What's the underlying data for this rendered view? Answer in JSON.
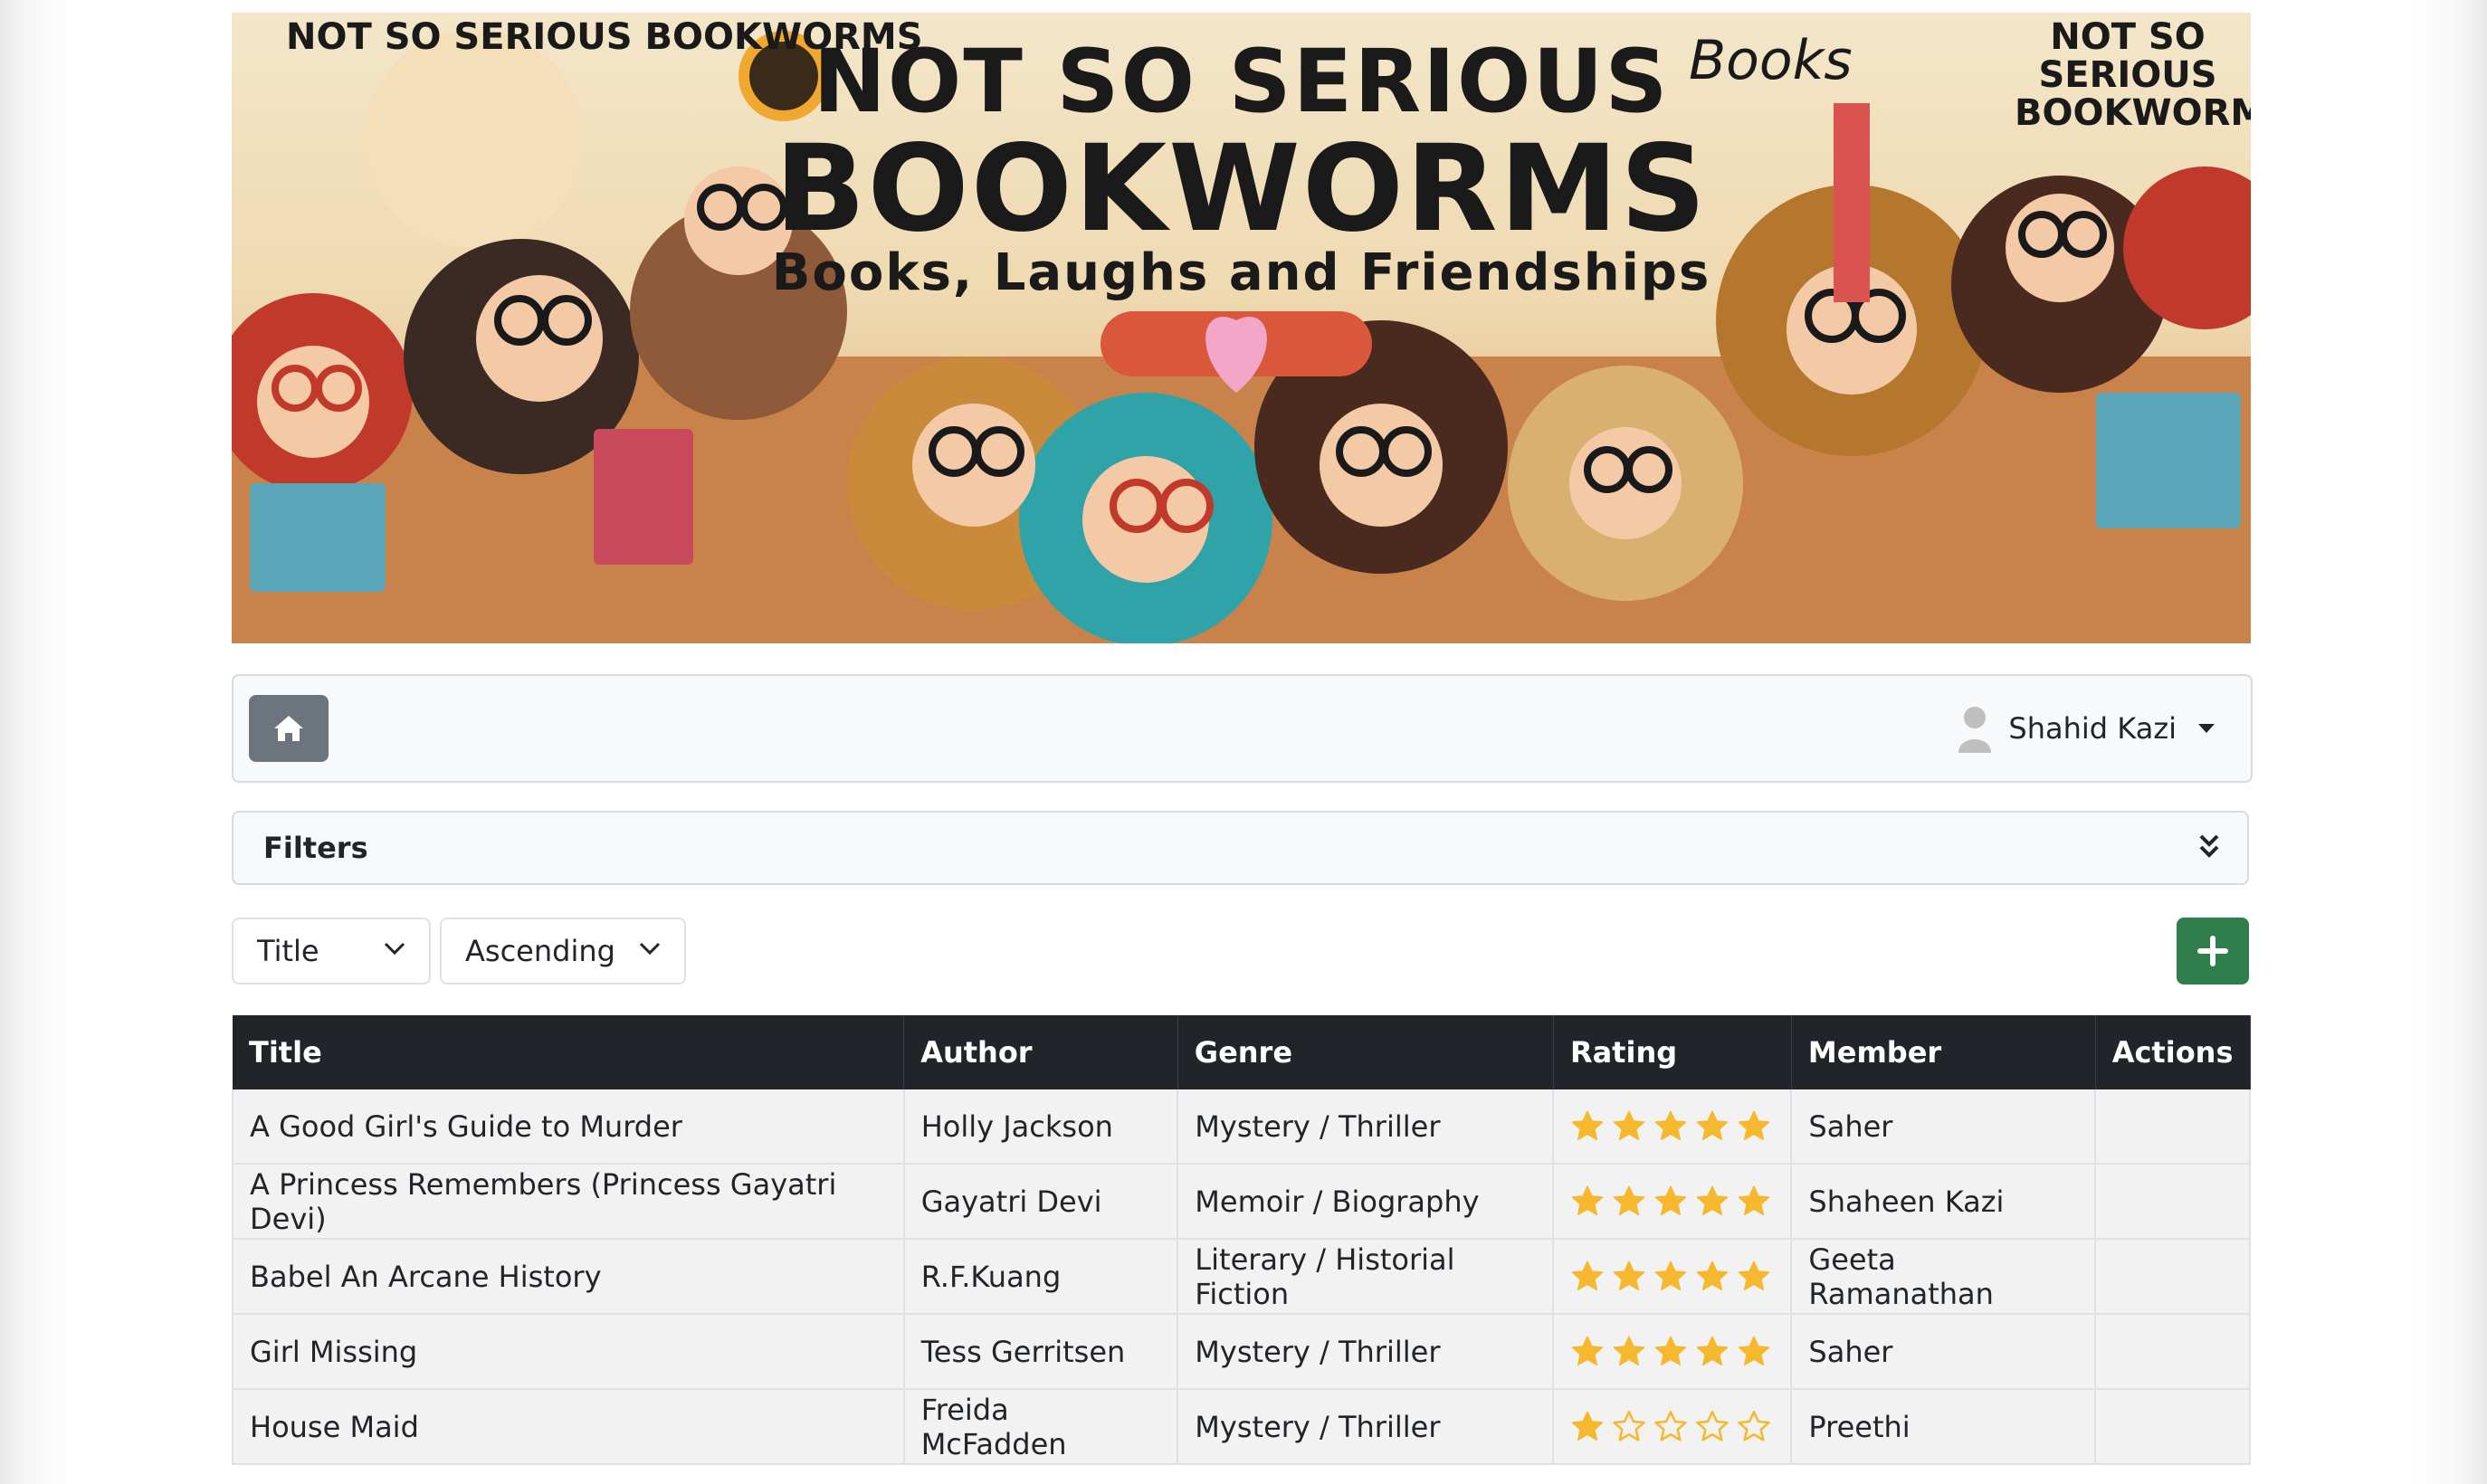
{
  "banner": {
    "title_line1": "NOT SO SERIOUS",
    "title_line2": "BOOKWORMS",
    "tagline": "Books, Laughs and Friendships",
    "corner_left": "NOT SO SERIOUS BOOKWORMS",
    "corner_right": "NOT SO SERIOUS BOOKWORMS",
    "books_word": "Books"
  },
  "navbar": {
    "home_icon": "home-icon",
    "user_name": "Shahid Kazi",
    "user_icon": "user-icon"
  },
  "filters": {
    "label": "Filters",
    "toggle_icon": "double-chevron-down-icon"
  },
  "sort": {
    "field": "Title",
    "direction": "Ascending"
  },
  "add_button": {
    "icon": "plus-icon",
    "color": "#2f7d4a"
  },
  "table": {
    "columns": [
      "Title",
      "Author",
      "Genre",
      "Rating",
      "Member",
      "Actions"
    ],
    "rows": [
      {
        "title": "A Good Girl's Guide to Murder",
        "author": "Holly Jackson",
        "genre": "Mystery / Thriller",
        "rating": 5,
        "member": "Saher"
      },
      {
        "title": "A Princess Remembers (Princess Gayatri Devi)",
        "author": "Gayatri Devi",
        "genre": "Memoir / Biography",
        "rating": 5,
        "member": "Shaheen Kazi"
      },
      {
        "title": "Babel An Arcane History",
        "author": "R.F.Kuang",
        "genre": "Literary / Historial Fiction",
        "rating": 5,
        "member": "Geeta Ramanathan"
      },
      {
        "title": "Girl Missing",
        "author": "Tess Gerritsen",
        "genre": "Mystery / Thriller",
        "rating": 5,
        "member": "Saher"
      },
      {
        "title": "House Maid",
        "author": "Freida McFadden",
        "genre": "Mystery / Thriller",
        "rating": 1,
        "member": "Preethi"
      }
    ],
    "rating_max": 5,
    "star_color": "#f5b82e"
  }
}
